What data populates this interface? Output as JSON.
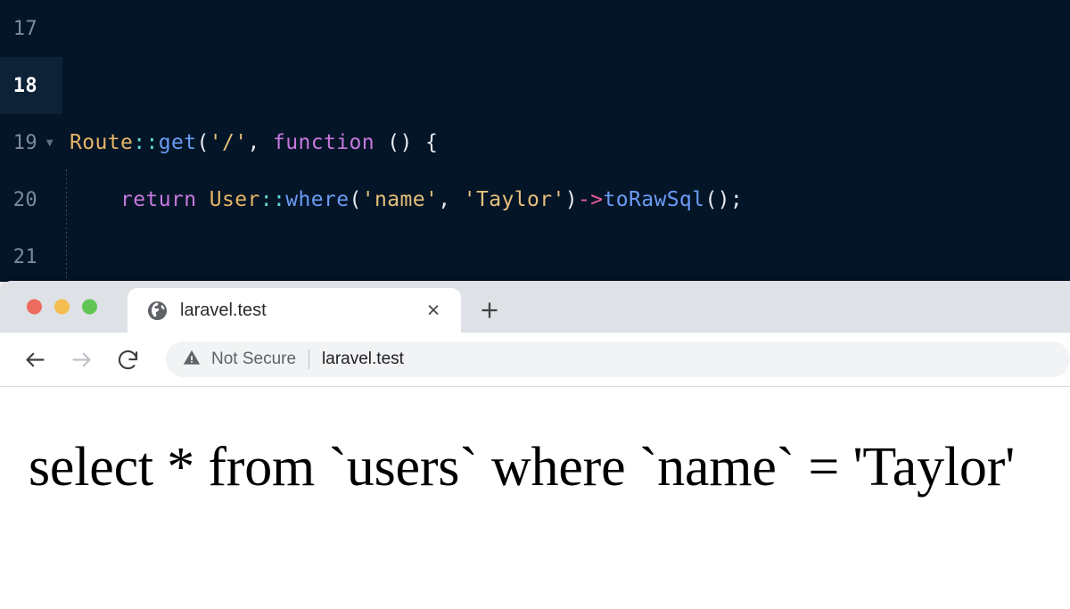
{
  "editor": {
    "lines": [
      {
        "number": "17",
        "fold": "",
        "active": false,
        "tokens": []
      },
      {
        "number": "18",
        "fold": "",
        "active": true,
        "tokens": []
      },
      {
        "number": "19",
        "fold": "▼",
        "active": false,
        "tokens": [
          {
            "text": "Route",
            "cls": "t-class"
          },
          {
            "text": "::",
            "cls": "t-op"
          },
          {
            "text": "get",
            "cls": "t-fn"
          },
          {
            "text": "(",
            "cls": "t-plain"
          },
          {
            "text": "'/'",
            "cls": "t-str"
          },
          {
            "text": ", ",
            "cls": "t-plain"
          },
          {
            "text": "function",
            "cls": "t-kw"
          },
          {
            "text": " () {",
            "cls": "t-plain"
          }
        ]
      },
      {
        "number": "20",
        "fold": "",
        "active": false,
        "tokens": [
          {
            "text": "    ",
            "cls": "t-plain"
          },
          {
            "text": "return",
            "cls": "t-kw"
          },
          {
            "text": " ",
            "cls": "t-plain"
          },
          {
            "text": "User",
            "cls": "t-class"
          },
          {
            "text": "::",
            "cls": "t-op"
          },
          {
            "text": "where",
            "cls": "t-fn"
          },
          {
            "text": "(",
            "cls": "t-plain"
          },
          {
            "text": "'name'",
            "cls": "t-str"
          },
          {
            "text": ", ",
            "cls": "t-plain"
          },
          {
            "text": "'Taylor'",
            "cls": "t-str"
          },
          {
            "text": ")",
            "cls": "t-plain"
          },
          {
            "text": "->",
            "cls": "t-arrow"
          },
          {
            "text": "toRawSql",
            "cls": "t-fn"
          },
          {
            "text": "();",
            "cls": "t-plain"
          }
        ]
      },
      {
        "number": "21",
        "fold": "",
        "active": false,
        "tokens": []
      }
    ],
    "background_color": "#041527",
    "active_line_highlight": "#0d2137"
  },
  "browser": {
    "traffic_lights": {
      "close_color": "#ed6a5e",
      "minimize_color": "#f5bd4f",
      "maximize_color": "#61c554"
    },
    "tab": {
      "favicon": "globe-icon",
      "title": "laravel.test",
      "close_label": "×"
    },
    "new_tab_label": "+",
    "toolbar": {
      "back_icon": "back-arrow-icon",
      "forward_icon": "forward-arrow-icon",
      "reload_icon": "reload-icon",
      "security_icon": "warning-triangle-icon",
      "security_text": "Not Secure",
      "url": "laravel.test"
    }
  },
  "page": {
    "sql_output": "select * from `users` where `name` = 'Taylor'"
  }
}
